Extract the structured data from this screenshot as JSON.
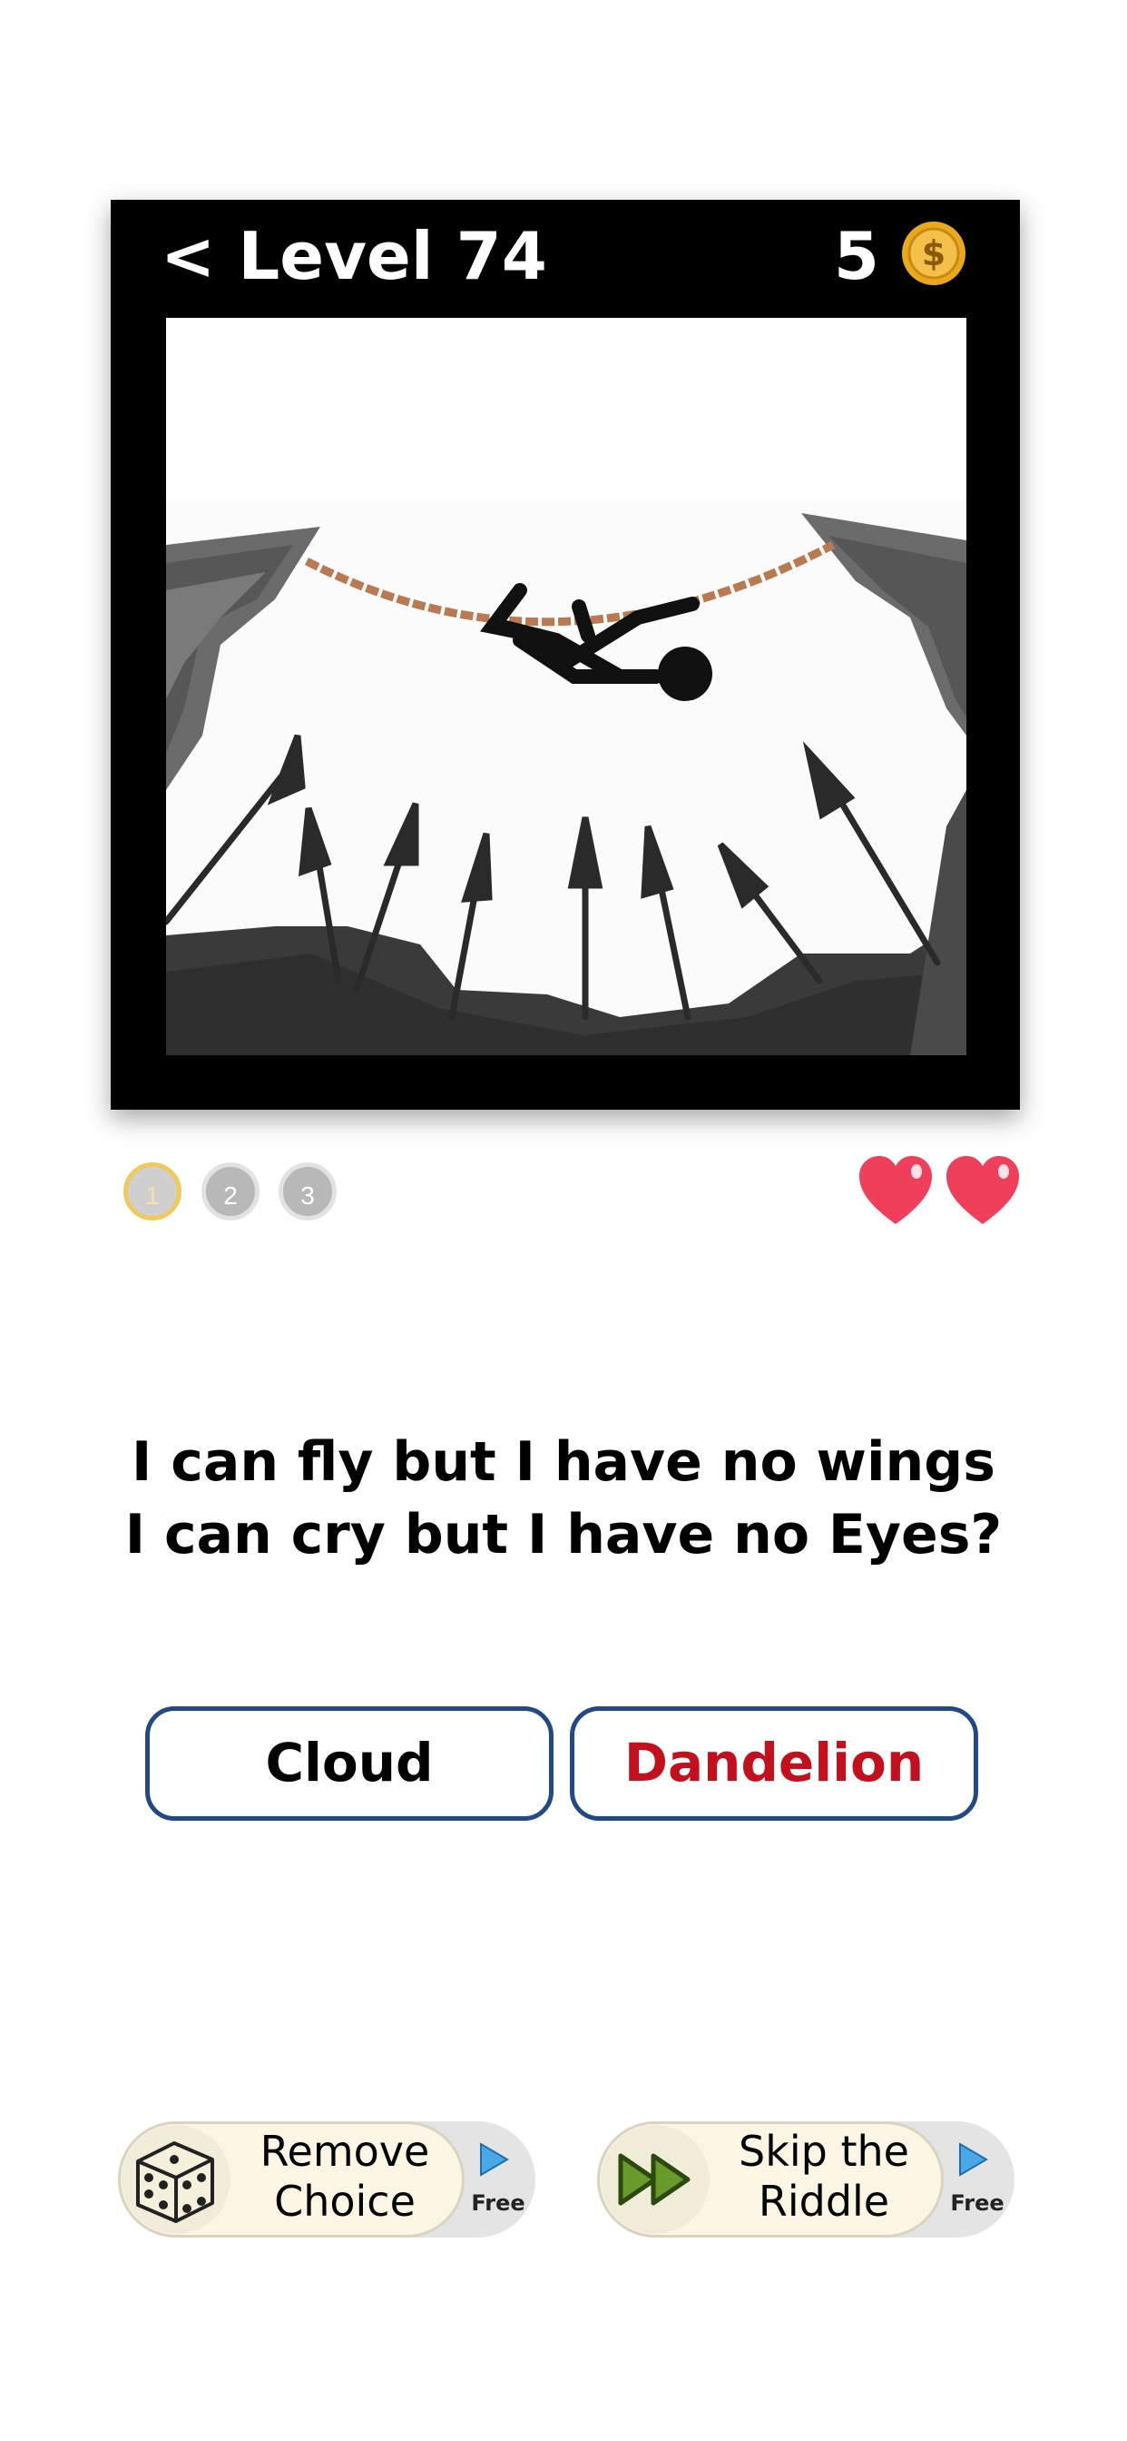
{
  "header": {
    "back_glyph": "<",
    "level_label": "Level 74",
    "coin_count": "5",
    "coin_symbol": "$"
  },
  "scene_icons": [
    "rope-icon",
    "stickman-icon",
    "cliff-icon",
    "spike-icon"
  ],
  "progress": {
    "steps": [
      "1",
      "2",
      "3"
    ],
    "current": 1
  },
  "lives": {
    "count": 2,
    "icon": "heart-icon",
    "color": "#ef3f5a"
  },
  "riddle": {
    "line1": "I can fly but I have no wings",
    "line2": "I can cry but I have no Eyes?"
  },
  "choices": [
    {
      "label": "Cloud"
    },
    {
      "label": "Dandelion"
    }
  ],
  "helpers": [
    {
      "label_line1": "Remove",
      "label_line2": "Choice",
      "tag": "Free",
      "icon": "dice-icon"
    },
    {
      "label_line1": "Skip the",
      "label_line2": "Riddle",
      "tag": "Free",
      "icon": "fast-forward-icon"
    }
  ],
  "colors": {
    "choice_border": "#1f4a86",
    "wrong_choice_text": "#c4101c",
    "coin": "#e9a91b",
    "heart": "#ef3f5a"
  }
}
